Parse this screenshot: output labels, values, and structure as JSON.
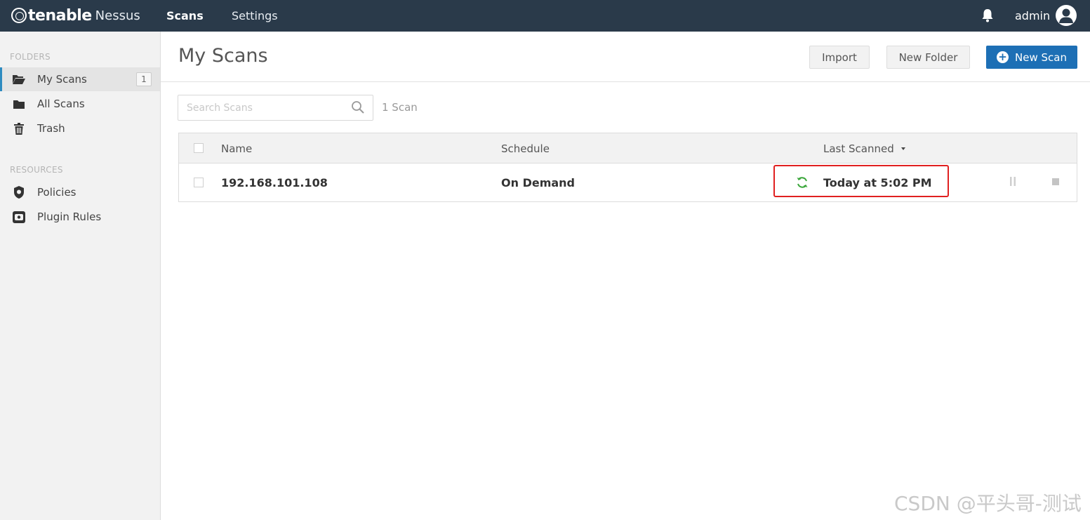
{
  "topbar": {
    "brand": "tenable",
    "product": "Nessus",
    "nav": {
      "scans": "Scans",
      "settings": "Settings"
    },
    "user": "admin",
    "icons": {
      "notifications": "bell-icon",
      "user": "user-avatar-icon"
    }
  },
  "sidebar": {
    "folders_label": "FOLDERS",
    "folders": [
      {
        "label": "My Scans",
        "count": "1",
        "icon": "folder-open-icon",
        "active": true
      },
      {
        "label": "All Scans",
        "icon": "folder-icon"
      },
      {
        "label": "Trash",
        "icon": "trash-icon"
      }
    ],
    "resources_label": "RESOURCES",
    "resources": [
      {
        "label": "Policies",
        "icon": "shield-icon"
      },
      {
        "label": "Plugin Rules",
        "icon": "plugin-rules-icon"
      }
    ]
  },
  "main": {
    "title": "My Scans",
    "buttons": {
      "import": "Import",
      "new_folder": "New Folder",
      "new_scan": "New Scan"
    },
    "search_placeholder": "Search Scans",
    "scan_count": "1 Scan",
    "table": {
      "headers": {
        "name": "Name",
        "schedule": "Schedule",
        "last_scanned": "Last Scanned"
      },
      "rows": [
        {
          "name": "192.168.101.108",
          "schedule": "On Demand",
          "last_scanned": "Today at 5:02 PM",
          "status": "running"
        }
      ]
    }
  },
  "colors": {
    "topbar": "#2a3a4a",
    "accent": "#1d6fb5",
    "running": "#3aa63a",
    "highlight": "#e02020"
  },
  "watermark": "CSDN @平头哥-测试"
}
